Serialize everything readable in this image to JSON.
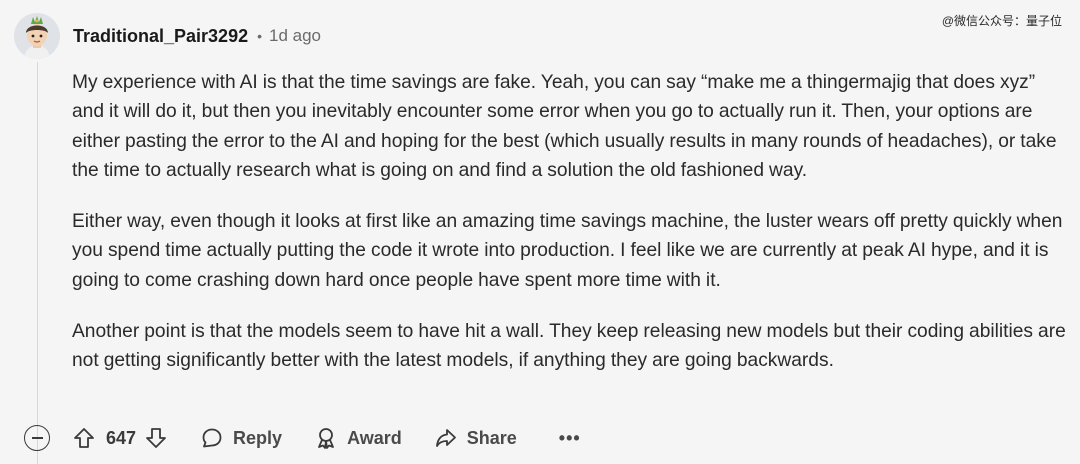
{
  "comment": {
    "author": "Traditional_Pair3292",
    "separator": "•",
    "time_ago": "1d ago",
    "paragraphs": [
      "My experience with AI is that the time savings are fake. Yeah, you can say “make me a thingermajig that does xyz” and it will do it, but then you inevitably encounter some error when you go to actually run it. Then, your options are either pasting the error to the AI and hoping for the best (which usually results in many rounds of headaches), or take the time to actually research what is going on and find a solution the old fashioned way.",
      "Either way, even though it looks at first like an amazing time savings machine, the luster wears off pretty quickly when you spend time actually putting the code it wrote into production. I feel like we are currently at peak AI hype, and it is going to come crashing down hard once people have spent more time with it.",
      "Another point is that the models seem to have hit a wall. They keep releasing new models but their coding abilities are not getting significantly better with the latest models, if anything they are going backwards."
    ]
  },
  "watermark": "@微信公众号：量子位",
  "actions": {
    "score": "647",
    "reply_label": "Reply",
    "award_label": "Award",
    "share_label": "Share",
    "more_label": "•••"
  },
  "icons": [
    "avatar",
    "collapse-icon",
    "upvote-icon",
    "downvote-icon",
    "reply-icon",
    "award-icon",
    "share-icon",
    "more-icon"
  ]
}
